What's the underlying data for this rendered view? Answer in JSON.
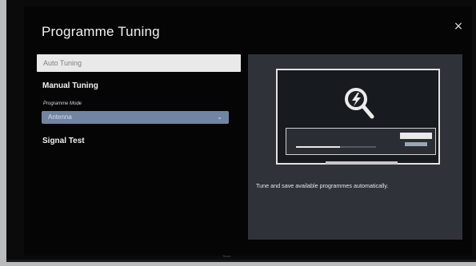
{
  "panel": {
    "title": "Programme Tuning",
    "close_label": "×"
  },
  "menu": {
    "auto_tuning": "Auto Tuning",
    "manual_tuning": "Manual Tuning",
    "programme_mode_label": "Programme Mode",
    "programme_mode_value": "Antenna",
    "signal_test": "Signal Test"
  },
  "info": {
    "description": "Tune and save available programmes automatically.",
    "illustration_icon": "search-lightning-icon",
    "progress_fraction": 0.55
  },
  "footer": {
    "text": "Tinsei"
  },
  "colors": {
    "select_bg": "#7185a3",
    "panel_bg": "#2f3339",
    "screen_bg": "#050506"
  }
}
